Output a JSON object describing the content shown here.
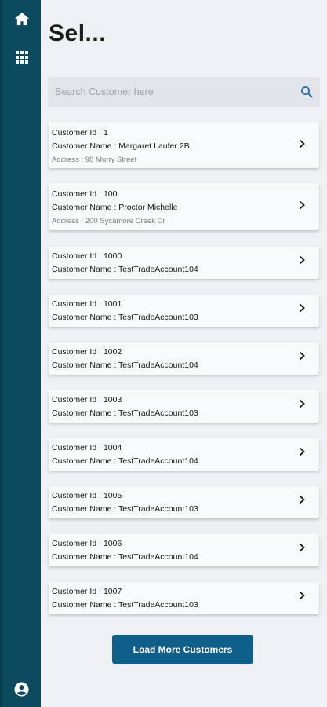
{
  "colors": {
    "rail": "#0b4a5f",
    "background": "#eef0f3",
    "card": "#f8f9fa",
    "button": "#0e5f8a",
    "search_icon": "#2f6fa8"
  },
  "rail": {
    "icons": [
      "home-icon",
      "grid-icon",
      "account-icon"
    ]
  },
  "page": {
    "title": "Sel..."
  },
  "search": {
    "placeholder": "Search Customer here",
    "value": ""
  },
  "customers": [
    {
      "id_label": "Customer Id : 1",
      "name_label": "Customer Name : Margaret Laufer 2B",
      "address_label": "Address : 98 Murry Street"
    },
    {
      "id_label": "Customer Id : 100",
      "name_label": "Customer Name : Proctor Michelle",
      "address_label": "Address : 200 Sycamore Creek Dr"
    },
    {
      "id_label": "Customer Id : 1000",
      "name_label": "Customer Name : TestTradeAccount104"
    },
    {
      "id_label": "Customer Id : 1001",
      "name_label": "Customer Name : TestTradeAccount103"
    },
    {
      "id_label": "Customer Id : 1002",
      "name_label": "Customer Name : TestTradeAccount104"
    },
    {
      "id_label": "Customer Id : 1003",
      "name_label": "Customer Name : TestTradeAccount103"
    },
    {
      "id_label": "Customer Id : 1004",
      "name_label": "Customer Name : TestTradeAccount104"
    },
    {
      "id_label": "Customer Id : 1005",
      "name_label": "Customer Name : TestTradeAccount103"
    },
    {
      "id_label": "Customer Id : 1006",
      "name_label": "Customer Name : TestTradeAccount104"
    },
    {
      "id_label": "Customer Id : 1007",
      "name_label": "Customer Name : TestTradeAccount103"
    }
  ],
  "load_more": {
    "label": "Load More Customers"
  }
}
